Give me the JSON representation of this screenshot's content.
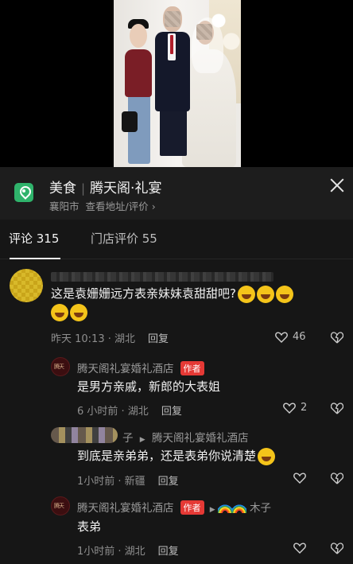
{
  "header": {
    "category": "美食",
    "name": "腾天阁·礼宴",
    "city": "襄阳市",
    "address_link": "查看地址/评价",
    "address_chevron": "›"
  },
  "tabs": [
    {
      "label": "评论 315",
      "active": true
    },
    {
      "label": "门店评价 55",
      "active": false
    }
  ],
  "comments": [
    {
      "text": "这是袁姗姗远方表亲妹妹袁甜甜吧?",
      "time_location": "昨天 10:13 · 湖北",
      "reply": "回复",
      "likes": "46"
    }
  ],
  "replies": [
    {
      "author": "腾天阁礼宴婚礼酒店",
      "badge": "作者",
      "text": "是男方亲戚，新郎的大表姐",
      "time_location": "6 小时前 · 湖北",
      "reply": "回复",
      "likes": "2"
    },
    {
      "author_suffix": "子",
      "arrow": "▶",
      "target": "腾天阁礼宴婚礼酒店",
      "text": "到底是亲弟弟，还是表弟你说清楚",
      "time_location": "1小时前 · 新疆",
      "reply": "回复"
    },
    {
      "author": "腾天阁礼宴婚礼酒店",
      "badge": "作者",
      "arrow": "▶",
      "target": "木子",
      "text": "表弟",
      "time_location": "1小时前 · 湖北",
      "reply": "回复"
    }
  ],
  "avatar_logo_text": "腾天"
}
